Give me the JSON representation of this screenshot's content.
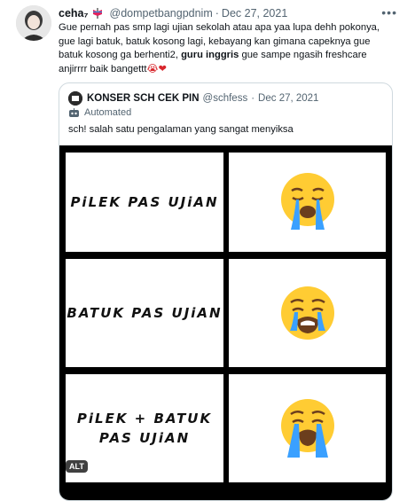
{
  "tweet": {
    "author_name": "ceha₇",
    "handle": "@dompetbangpdnim",
    "separator": "·",
    "date": "Dec 27, 2021",
    "more_label": "•••",
    "text_part1": "Gue pernah pas smp lagi ujian sekolah atau apa yaa lupa dehh pokonya, gue lagi batuk, batuk kosong lagi, kebayang kan gimana capeknya gue batuk kosong ga berhenti2, ",
    "text_bold": "guru inggris",
    "text_part2": " gue sampe ngasih freshcare anjirrrr baik bangettt",
    "emoji_tail": "😭❤"
  },
  "quote": {
    "author_name": "KONSER SCH CEK PIN",
    "handle": "@schfess",
    "separator": "·",
    "date": "Dec 27, 2021",
    "automated_label": "Automated",
    "text": "sch! salah satu pengalaman yang sangat menyiksa"
  },
  "meme": {
    "rows": [
      {
        "label_line1": "PiLEK PAS UJiAN",
        "label_line2": "",
        "emoji": "crying-face-level-1"
      },
      {
        "label_line1": "BATUK PAS UJiAN",
        "label_line2": "",
        "emoji": "crying-face-level-2"
      },
      {
        "label_line1": "PiLEK + BATUK",
        "label_line2": "PAS UJiAN",
        "emoji": "crying-face-level-3"
      }
    ],
    "alt_badge": "ALT"
  },
  "colors": {
    "text_primary": "#0f1419",
    "text_secondary": "#536471",
    "border": "#cfd9de",
    "heart": "#d8262c",
    "emoji_yellow": "#ffcc33",
    "tear_blue": "#3aa0ff"
  }
}
